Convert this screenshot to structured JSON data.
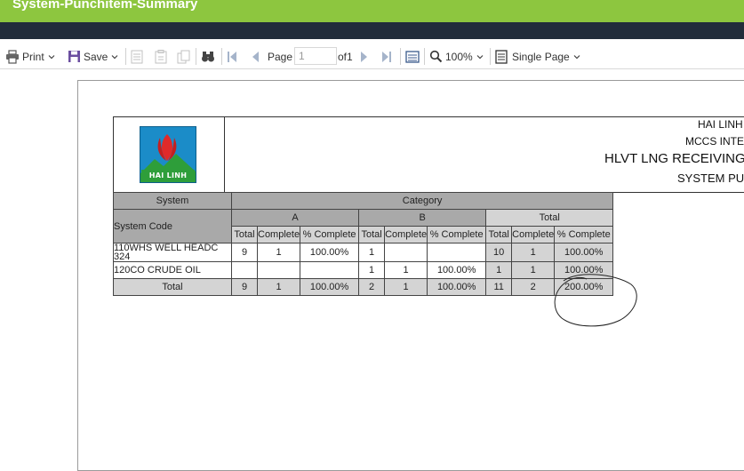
{
  "window": {
    "title": "System-Punchitem-Summary"
  },
  "toolbar": {
    "print_label": "Print",
    "save_label": "Save",
    "page_label": "Page",
    "page_value": "1",
    "of_label": "of1",
    "zoom_label": "100%",
    "view_label": "Single Page"
  },
  "report": {
    "company_lines": [
      "HAI LINH",
      "MCCS INTE",
      "HLVT LNG RECEIVING",
      "SYSTEM PU"
    ],
    "logo_text": "HAI LINH",
    "table": {
      "system_header": "System",
      "category_header": "Category",
      "system_code_header": "System Code",
      "groups": [
        "A",
        "B",
        "Total"
      ],
      "sub_headers": [
        "Total",
        "Complete",
        "% Complete"
      ],
      "rows": [
        {
          "code": "110WHS WELL HEADC 324",
          "a_total": "9",
          "a_complete": "1",
          "a_pct": "100.00%",
          "b_total": "1",
          "b_complete": "",
          "b_pct": "",
          "t_total": "10",
          "t_complete": "1",
          "t_pct": "100.00%"
        },
        {
          "code": "120CO CRUDE OIL",
          "a_total": "",
          "a_complete": "",
          "a_pct": "",
          "b_total": "1",
          "b_complete": "1",
          "b_pct": "100.00%",
          "t_total": "1",
          "t_complete": "1",
          "t_pct": "100.00%"
        }
      ],
      "total_row": {
        "label": "Total",
        "a_total": "9",
        "a_complete": "1",
        "a_pct": "100.00%",
        "b_total": "2",
        "b_complete": "1",
        "b_pct": "100.00%",
        "t_total": "11",
        "t_complete": "2",
        "t_pct": "200.00%"
      }
    }
  },
  "colors": {
    "title_bar": "#8dc63f",
    "nav_bar": "#222d3b",
    "header_cell": "#a9a9a9",
    "light_cell": "#d4d4d4"
  }
}
